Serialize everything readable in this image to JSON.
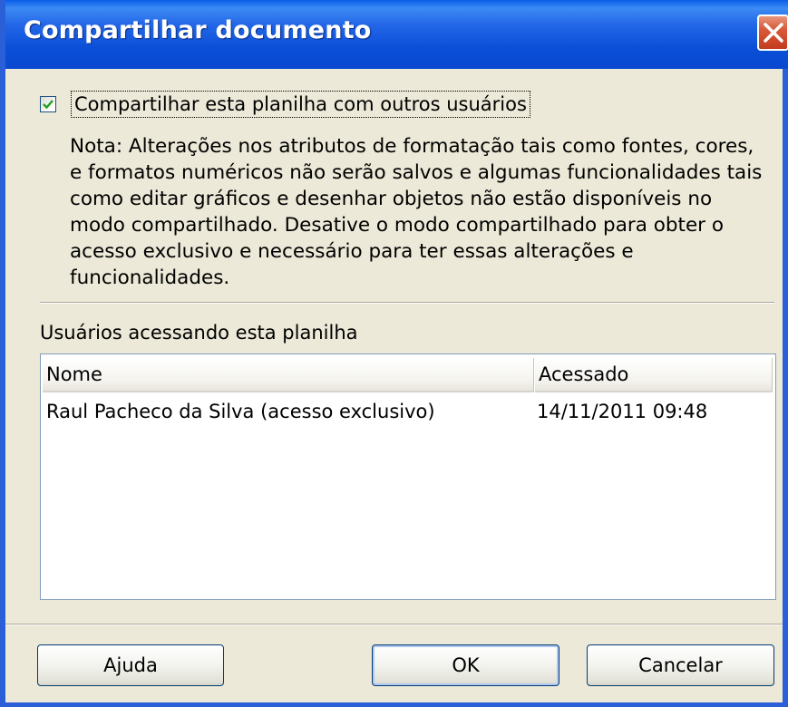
{
  "window": {
    "title": "Compartilhar documento",
    "close_icon": "close-icon"
  },
  "share": {
    "checkbox_label": "Compartilhar esta planilha com outros usuários",
    "checked": true,
    "note": "Nota: Alterações nos atributos de formatação tais como fontes, cores, e formatos numéricos não serão salvos e algumas funcionalidades tais como editar gráficos e desenhar objetos não estão disponíveis no modo compartilhado. Desative o modo compartilhado para obter o acesso exclusivo e necessário para ter essas alterações e funcionalidades."
  },
  "users": {
    "label": "Usuários acessando esta planilha",
    "columns": [
      "Nome",
      "Acessado"
    ],
    "rows": [
      {
        "nome": "Raul Pacheco da Silva (acesso exclusivo)",
        "acessado": "14/11/2011 09:48"
      }
    ]
  },
  "buttons": {
    "help": "Ajuda",
    "ok": "OK",
    "cancel": "Cancelar"
  },
  "colors": {
    "titlebar": "#0a4fd8",
    "close_button": "#d85a3a",
    "dialog_background": "#ece9d8",
    "check_mark": "#21a121"
  }
}
